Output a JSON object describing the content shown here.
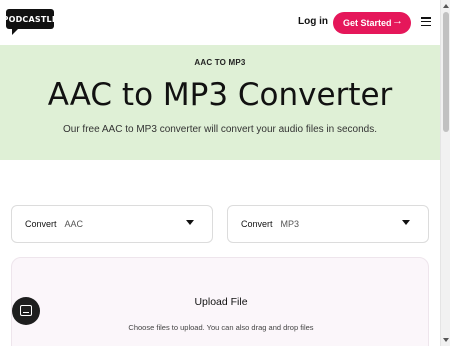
{
  "header": {
    "logo_text": "PODCASTLE",
    "login_label": "Log in",
    "cta_label": "Get Started",
    "cta_icon": "arrow-right-icon",
    "menu_icon": "hamburger-menu-icon",
    "cta_color": "#e5175a"
  },
  "hero": {
    "kicker": "AAC TO MP3",
    "title": "AAC to MP3 Converter",
    "subtitle": "Our free AAC to MP3 converter will convert your audio files in seconds.",
    "background": "#dff0d6"
  },
  "converter": {
    "from": {
      "label": "Convert",
      "value": "AAC"
    },
    "to": {
      "label": "Convert",
      "value": "MP3"
    }
  },
  "upload": {
    "title": "Upload File",
    "description": "Choose files to upload. You can also drag and drop files"
  },
  "chat": {
    "icon": "chat-icon"
  }
}
